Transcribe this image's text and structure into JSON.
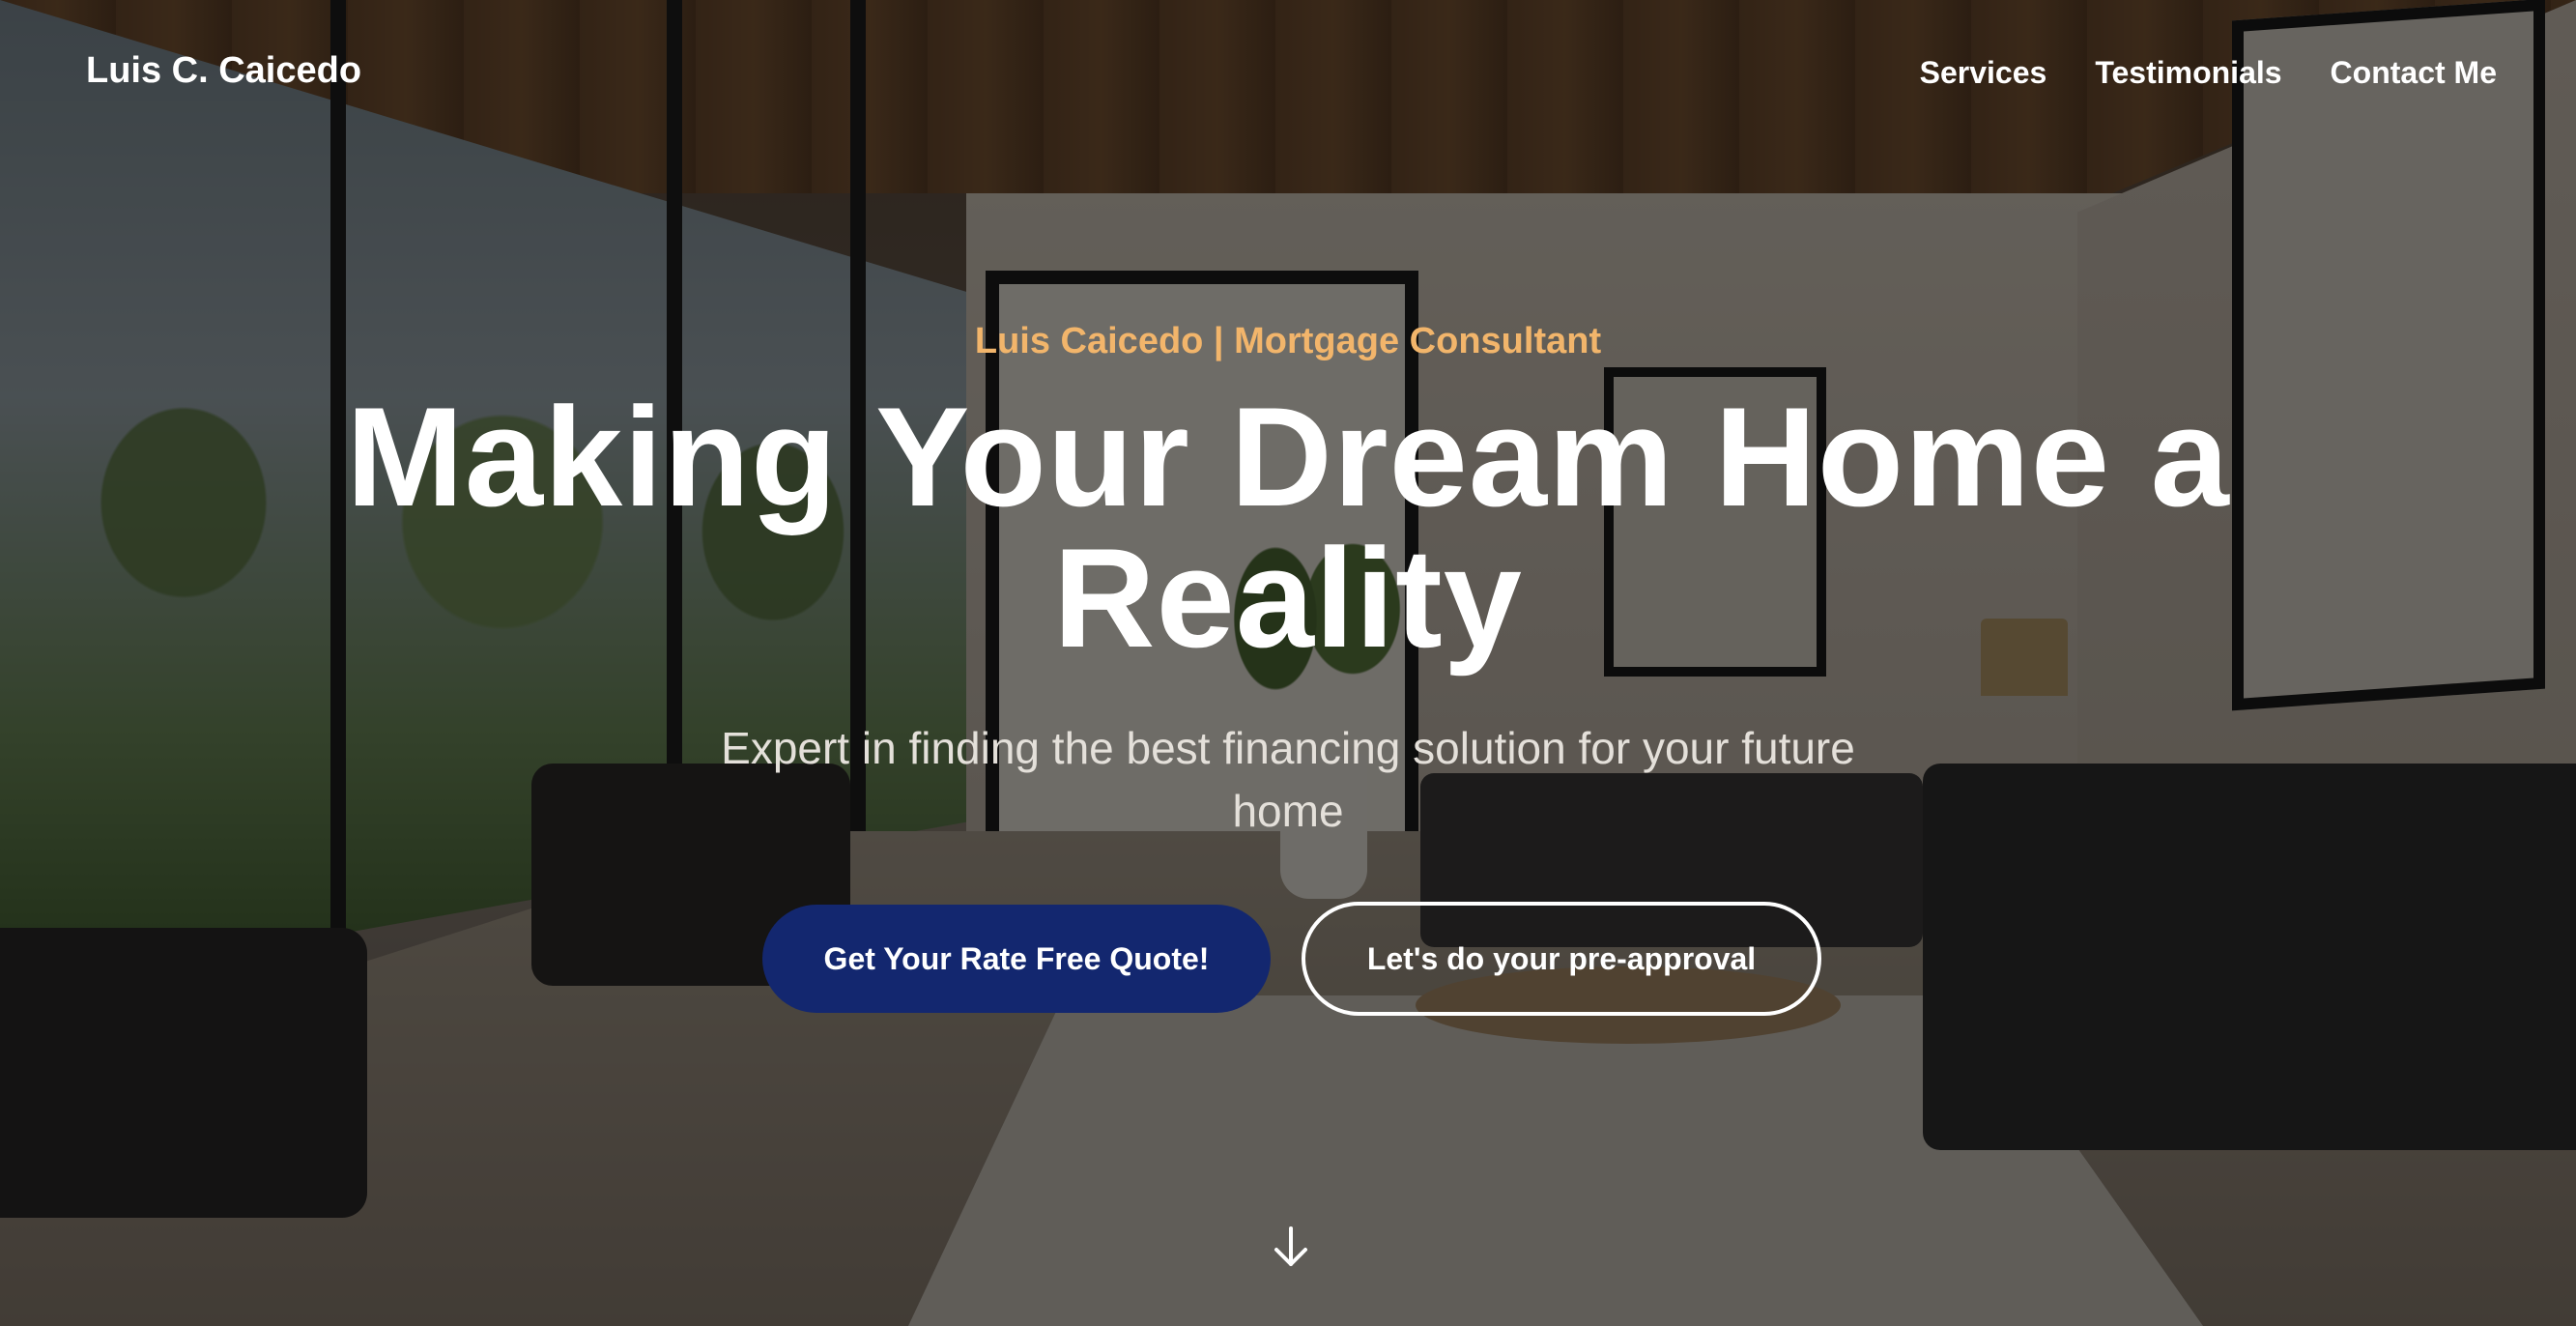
{
  "brand": "Luis C. Caicedo",
  "nav": {
    "items": [
      {
        "label": "Services"
      },
      {
        "label": "Testimonials"
      },
      {
        "label": "Contact Me"
      }
    ]
  },
  "hero": {
    "eyebrow": "Luis Caicedo | Mortgage Consultant",
    "headline_line1": "Making Your Dream Home a",
    "headline_line2": "Reality",
    "subhead_line1": "Expert in finding the best financing solution for your future",
    "subhead_line2": "home",
    "primary_cta": "Get Your Rate Free Quote!",
    "secondary_cta": "Let's do your pre-approval",
    "scroll_icon": "arrow-down-icon"
  },
  "colors": {
    "accent": "#f2b56b",
    "primary_button": "#13276f",
    "text": "#ffffff"
  }
}
